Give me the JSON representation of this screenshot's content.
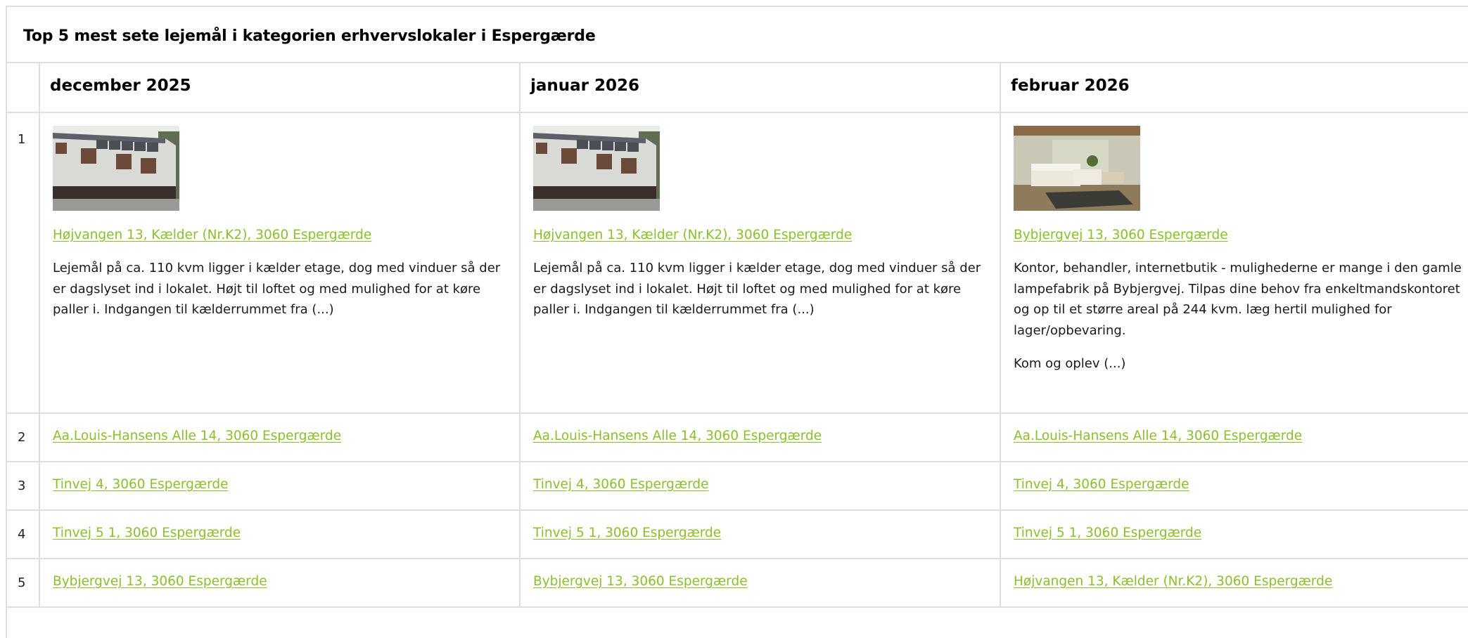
{
  "page": {
    "title": "Top 5 mest sete lejemål i kategorien erhvervslokaler i Espergærde"
  },
  "colors": {
    "link": "#8bbf2b",
    "border": "#dedede"
  },
  "columns": [
    "december 2025",
    "januar 2026",
    "februar 2026"
  ],
  "row1": {
    "rank": "1",
    "cells": [
      {
        "image": "building-photo",
        "link": "Højvangen 13, Kælder (Nr.K2), 3060 Espergærde",
        "description": "Lejemål på ca. 110 kvm ligger i kælder etage, dog med vinduer så der er dagslyset ind i lokalet. Højt til loftet og med mulighed for at køre paller i. Indgangen til kælderrummet fra (...)",
        "description2": ""
      },
      {
        "image": "building-photo",
        "link": "Højvangen 13, Kælder (Nr.K2), 3060 Espergærde",
        "description": "Lejemål på ca. 110 kvm ligger i kælder etage, dog med vinduer så der er dagslyset ind i lokalet. Højt til loftet og med mulighed for at køre paller i. Indgangen til kælderrummet fra (...)",
        "description2": ""
      },
      {
        "image": "interior-photo",
        "link": "Bybjergvej 13, 3060 Espergærde",
        "description": "Kontor, behandler, internetbutik - mulighederne er mange i den gamle lampefabrik på Bybjergvej. Tilpas dine behov fra enkeltmandskontoret og op til et større areal på 244 kvm. læg hertil mulighed for lager/opbevaring.",
        "description2": "Kom og oplev (...)"
      }
    ]
  },
  "rows": [
    {
      "rank": "2",
      "links": [
        "Aa.Louis-Hansens Alle 14, 3060 Espergærde",
        "Aa.Louis-Hansens Alle 14, 3060 Espergærde",
        "Aa.Louis-Hansens Alle 14, 3060 Espergærde"
      ]
    },
    {
      "rank": "3",
      "links": [
        "Tinvej 4, 3060 Espergærde",
        "Tinvej 4, 3060 Espergærde",
        "Tinvej 4, 3060 Espergærde"
      ]
    },
    {
      "rank": "4",
      "links": [
        "Tinvej 5 1, 3060 Espergærde",
        "Tinvej 5 1, 3060 Espergærde",
        "Tinvej 5 1, 3060 Espergærde"
      ]
    },
    {
      "rank": "5",
      "links": [
        "Bybjergvej 13, 3060 Espergærde",
        "Bybjergvej 13, 3060 Espergærde",
        "Højvangen 13, Kælder (Nr.K2), 3060 Espergærde"
      ]
    }
  ]
}
